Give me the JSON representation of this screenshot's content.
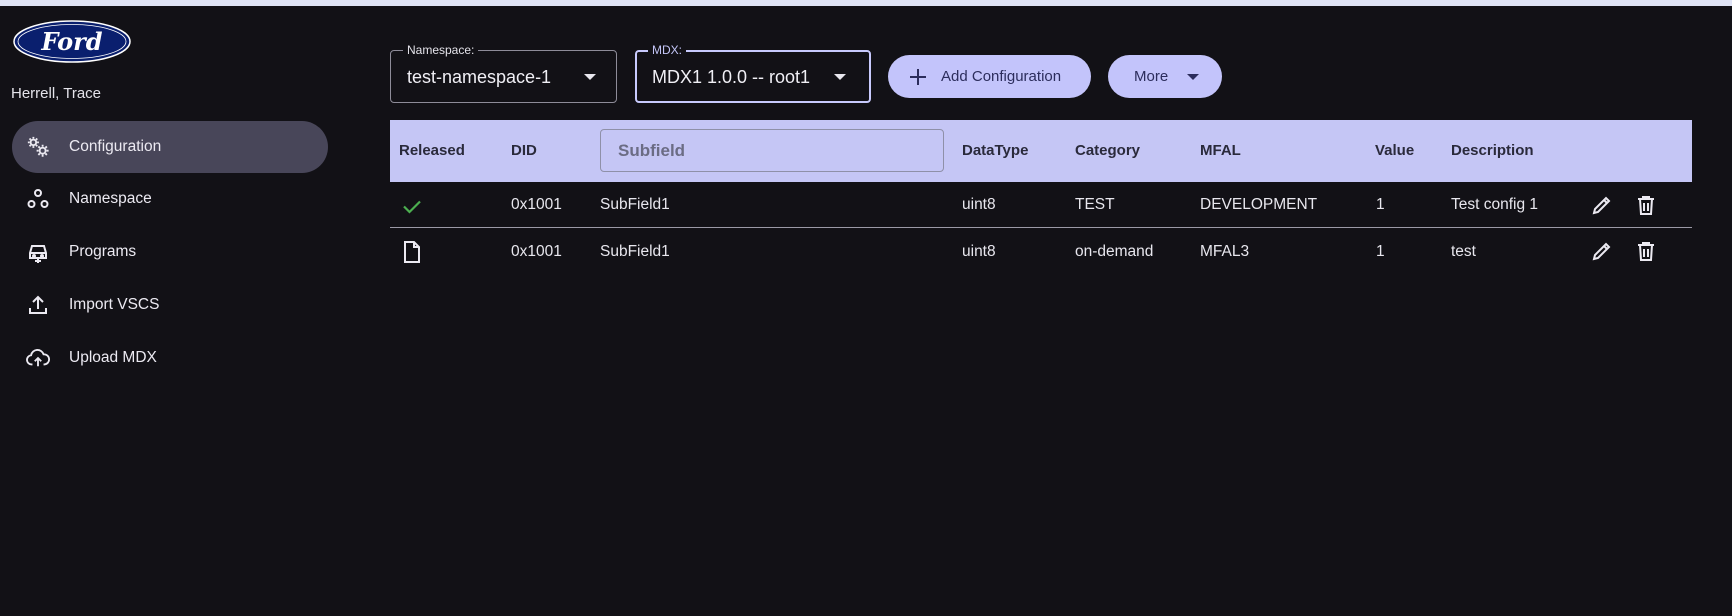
{
  "brand": {
    "logo_text": "Ford",
    "logo_color": "#0a1f6e"
  },
  "user": {
    "name": "Herrell, Trace"
  },
  "sidebar": {
    "items": [
      {
        "label": "Configuration",
        "icon": "gears-icon",
        "active": true
      },
      {
        "label": "Namespace",
        "icon": "nodes-icon",
        "active": false
      },
      {
        "label": "Programs",
        "icon": "vehicle-icon",
        "active": false
      },
      {
        "label": "Import VSCS",
        "icon": "upload-icon",
        "active": false
      },
      {
        "label": "Upload MDX",
        "icon": "cloud-upload-icon",
        "active": false
      }
    ]
  },
  "toolbar": {
    "namespace": {
      "legend": "Namespace:",
      "value": "test-namespace-1"
    },
    "mdx": {
      "legend": "MDX:",
      "value": "MDX1 1.0.0 -- root1"
    },
    "add_label": "Add Configuration",
    "more_label": "More"
  },
  "table": {
    "headers": {
      "released": "Released",
      "did": "DID",
      "subfield_placeholder": "Subfield",
      "datatype": "DataType",
      "category": "Category",
      "mfal": "MFAL",
      "value": "Value",
      "description": "Description"
    },
    "rows": [
      {
        "released_icon": "check-icon",
        "did": "0x1001",
        "subfield": "SubField1",
        "datatype": "uint8",
        "category": "TEST",
        "mfal": "DEVELOPMENT",
        "value": "1",
        "description": "Test config 1"
      },
      {
        "released_icon": "document-icon",
        "did": "0x1001",
        "subfield": "SubField1",
        "datatype": "uint8",
        "category": "on-demand",
        "mfal": "MFAL3",
        "value": "1",
        "description": "test"
      }
    ]
  },
  "colors": {
    "accent": "#c3c4fb",
    "header_bg": "#c5c6f5",
    "released_check": "#4caf50",
    "background": "#121116"
  }
}
